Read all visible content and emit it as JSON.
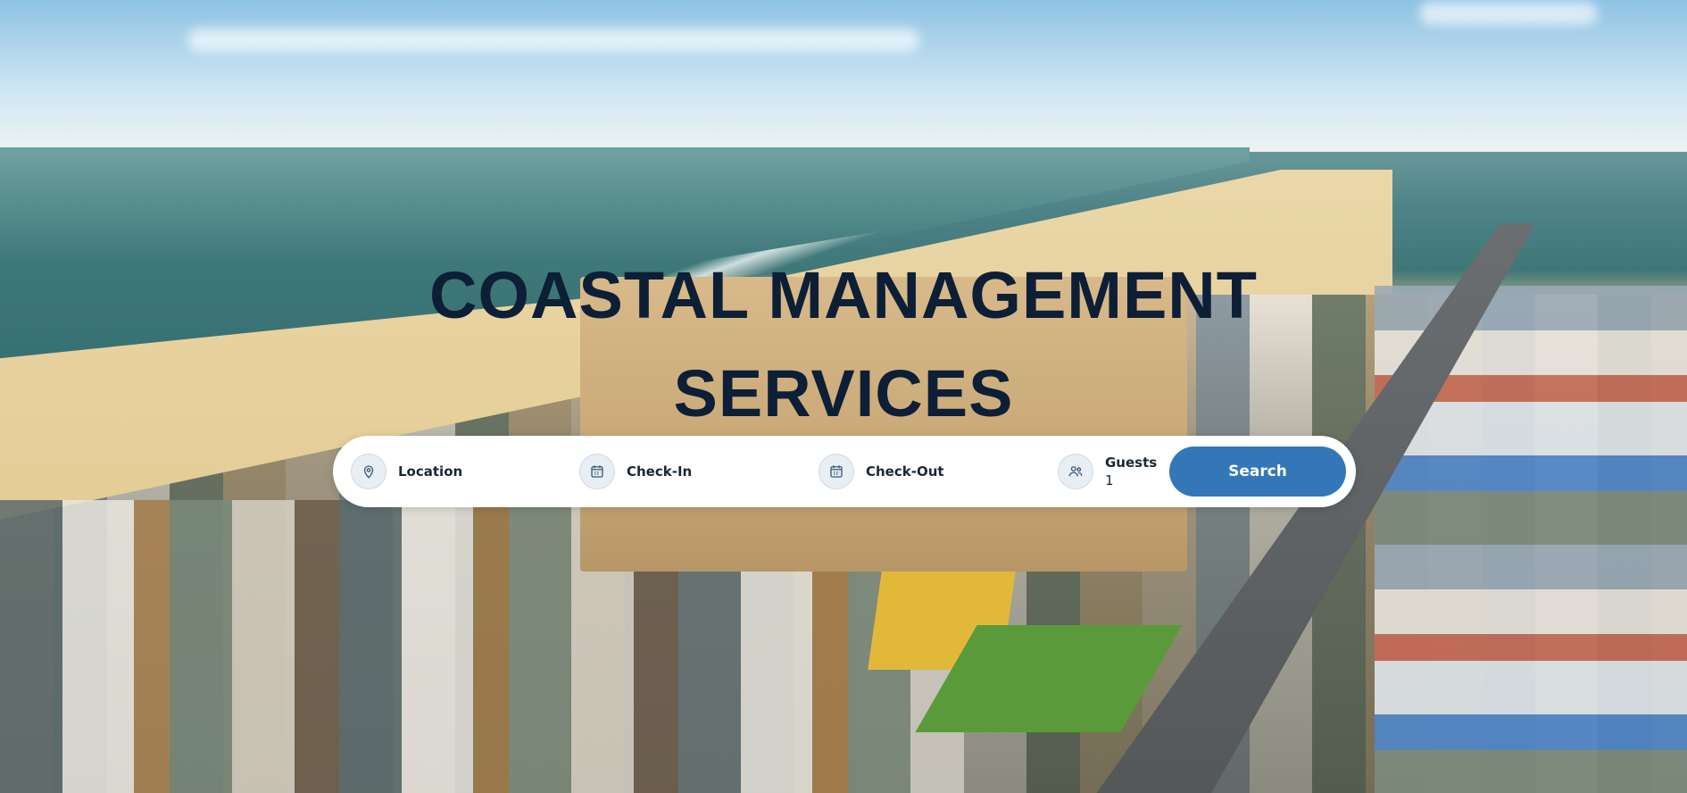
{
  "hero": {
    "title_line1": "COASTAL MANAGEMENT",
    "title_line2": "SERVICES"
  },
  "search": {
    "location_label": "Location",
    "checkin_label": "Check-In",
    "checkout_label": "Check-Out",
    "guests_label": "Guests",
    "guests_value": "1",
    "button_label": "Search"
  },
  "icons": {
    "location": "map-pin-icon",
    "checkin": "calendar-icon",
    "checkout": "calendar-icon",
    "guests": "users-icon"
  },
  "colors": {
    "title": "#0c1f36",
    "button": "#3377b8",
    "icon_bg": "#e9eef4"
  }
}
